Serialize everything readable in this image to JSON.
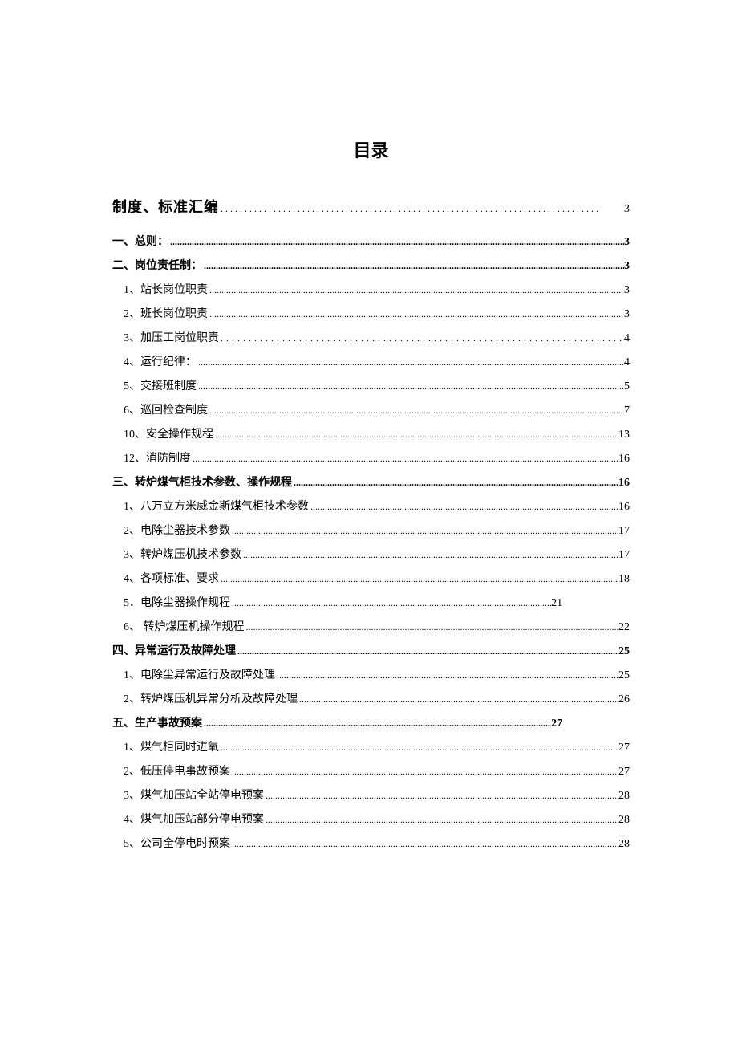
{
  "title": "目录",
  "main_entry": {
    "text": "制度、标准汇编",
    "page": "3"
  },
  "entries": [
    {
      "type": "section",
      "text": "一、总则：",
      "page": "3"
    },
    {
      "type": "section",
      "text": "二、岗位责任制：",
      "page": "3"
    },
    {
      "type": "sub",
      "text": "1、站长岗位职责",
      "page": "3"
    },
    {
      "type": "sub",
      "text": "2、班长岗位职责",
      "page": "3"
    },
    {
      "type": "sub",
      "text": "3、加压工岗位职责 ",
      "page": "4",
      "wide": true
    },
    {
      "type": "sub",
      "text": "4、运行纪律：",
      "page": "4"
    },
    {
      "type": "sub",
      "text": "5、交接班制度",
      "page": "5"
    },
    {
      "type": "sub",
      "text": "6、巡回检查制度",
      "page": "7"
    },
    {
      "type": "sub",
      "text": "10、安全操作规程",
      "page": "13"
    },
    {
      "type": "sub",
      "text": "12、消防制度",
      "page": "16"
    },
    {
      "type": "section",
      "text": "三、转炉煤气柜技术参数、操作规程",
      "page": "16"
    },
    {
      "type": "sub",
      "text": "1、八万立方米威金斯煤气柜技术参数",
      "page": "16"
    },
    {
      "type": "sub",
      "text": "2、电除尘器技术参数",
      "page": "17"
    },
    {
      "type": "sub",
      "text": "3、转炉煤压机技术参数",
      "page": "17"
    },
    {
      "type": "sub",
      "text": "4、各项标准、要求",
      "page": "18"
    },
    {
      "type": "sub",
      "text": "5．电除尘器操作规程",
      "page": "21",
      "short": true
    },
    {
      "type": "sub",
      "text": "6、 转炉煤压机操作规程",
      "page": "22"
    },
    {
      "type": "section",
      "text": "四、异常运行及故障处理",
      "page": "25"
    },
    {
      "type": "sub",
      "text": "1、电除尘异常运行及故障处理",
      "page": "25"
    },
    {
      "type": "sub",
      "text": "2、转炉煤压机异常分析及故障处理",
      "page": "26"
    },
    {
      "type": "section",
      "text": "五、生产事故预案",
      "page": "27",
      "short": true
    },
    {
      "type": "sub",
      "text": "1、煤气柜同时进氧",
      "page": "27"
    },
    {
      "type": "sub",
      "text": "2、低压停电事故预案",
      "page": "27"
    },
    {
      "type": "sub",
      "text": "3、煤气加压站全站停电预案",
      "page": "28"
    },
    {
      "type": "sub",
      "text": "4、煤气加压站部分停电预案",
      "page": "28"
    },
    {
      "type": "sub",
      "text": "5、公司全停电时预案",
      "page": "28"
    }
  ]
}
